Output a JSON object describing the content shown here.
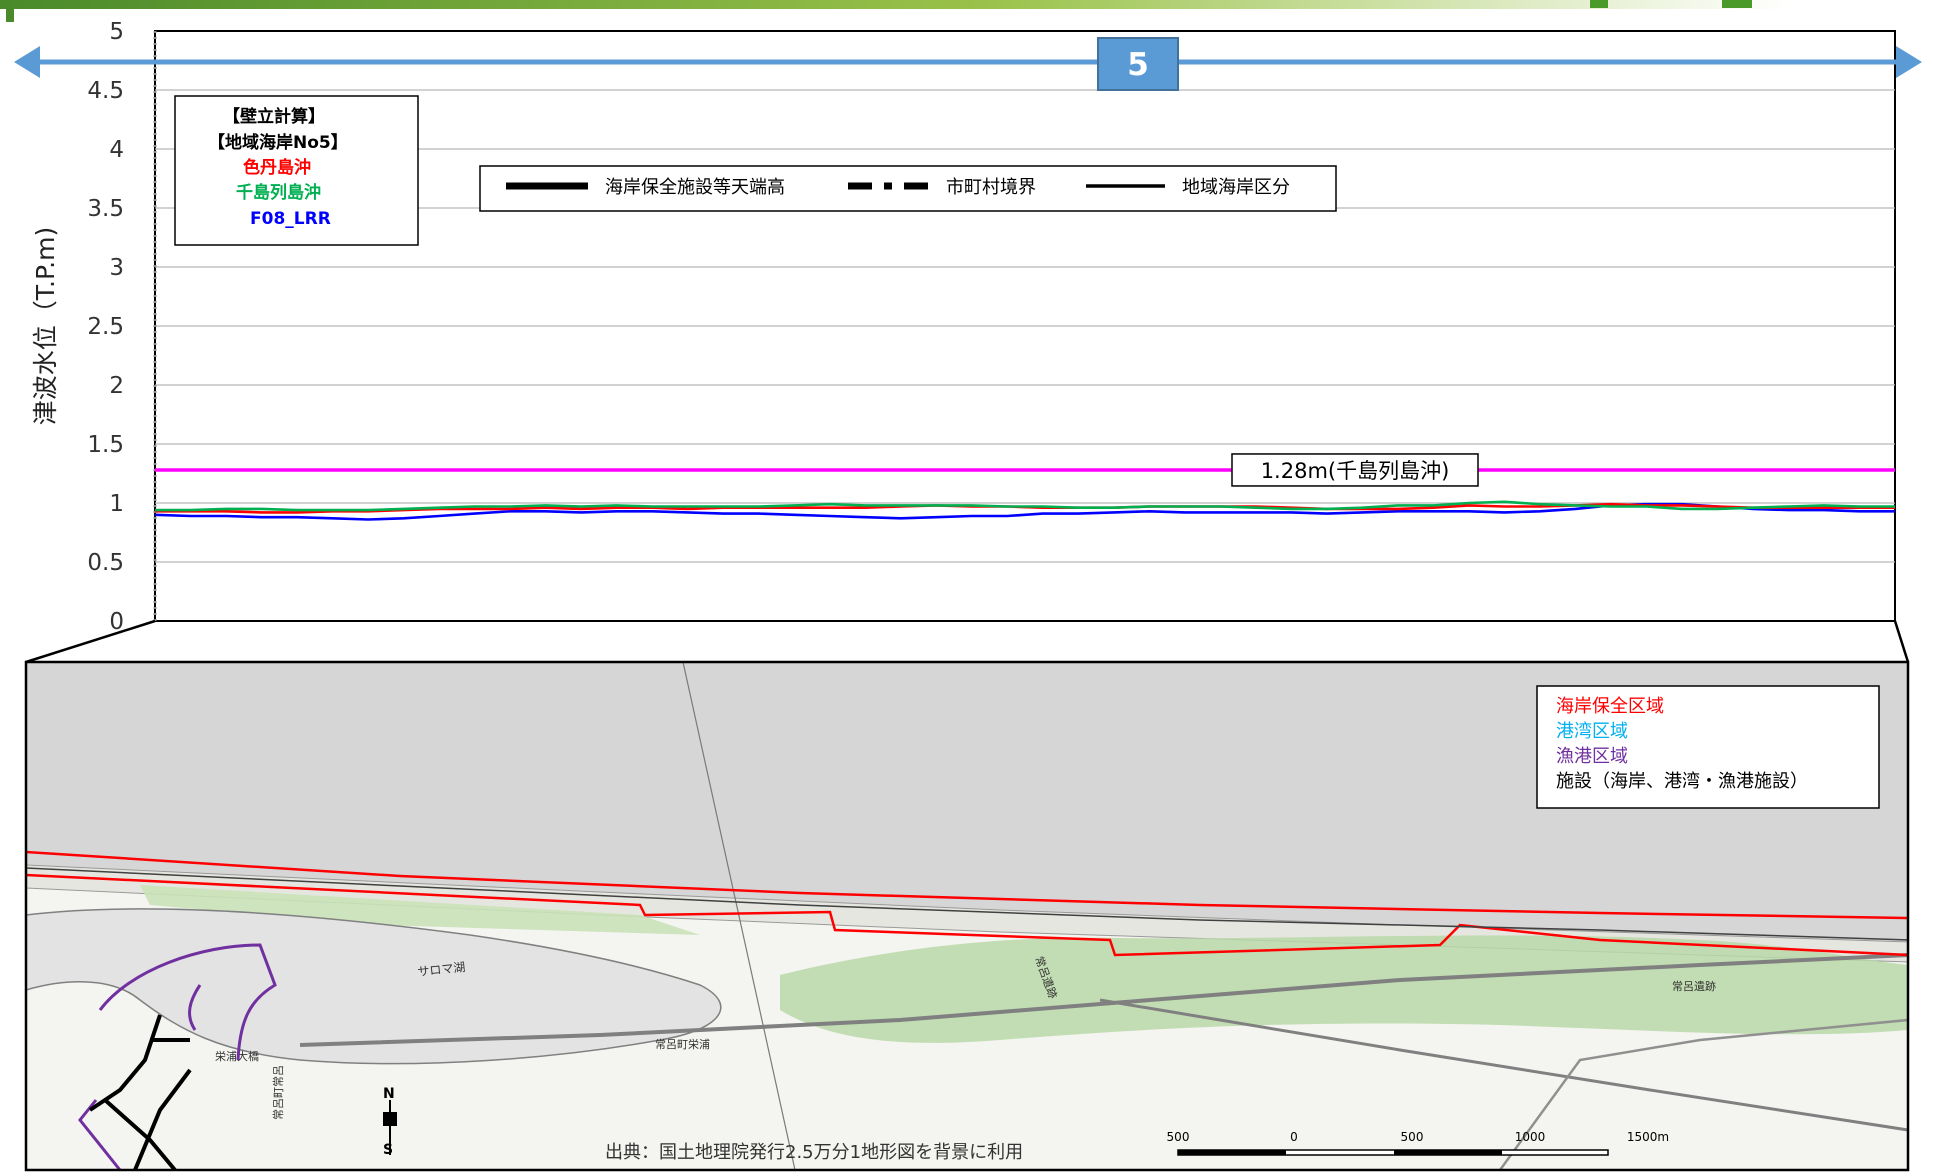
{
  "chart_data": {
    "type": "line",
    "ylabel": "津波水位（T.P.m)",
    "ylim": [
      0,
      5
    ],
    "yticks": [
      "0",
      "0.5",
      "1",
      "1.5",
      "2",
      "2.5",
      "3",
      "3.5",
      "4",
      "4.5",
      "5"
    ],
    "grid": true,
    "section_badge": "5",
    "info_box": {
      "line1": "【壁立計算】",
      "line2": "【地域海岸No5】",
      "line3": "色丹島沖",
      "line4": "千島列島沖",
      "line5": "F08_LRR"
    },
    "legend": {
      "item1": "海岸保全施設等天端高",
      "item2": "市町村境界",
      "item3": "地域海岸区分"
    },
    "reference_line": {
      "value": 1.28,
      "label": "1.28m(千島列島沖)",
      "color": "#ff00ff"
    },
    "series": [
      {
        "name": "色丹島沖",
        "color": "#ff0000",
        "values": [
          0.93,
          0.93,
          0.93,
          0.92,
          0.92,
          0.93,
          0.93,
          0.94,
          0.95,
          0.95,
          0.95,
          0.96,
          0.95,
          0.96,
          0.96,
          0.95,
          0.96,
          0.96,
          0.96,
          0.96,
          0.96,
          0.97,
          0.98,
          0.97,
          0.97,
          0.96,
          0.96,
          0.96,
          0.97,
          0.97,
          0.97,
          0.97,
          0.96,
          0.95,
          0.95,
          0.95,
          0.96,
          0.98,
          0.97,
          0.97,
          0.98,
          0.99,
          0.98,
          0.98,
          0.97,
          0.96,
          0.96,
          0.96,
          0.96,
          0.96
        ]
      },
      {
        "name": "千島列島沖",
        "color": "#00b050",
        "values": [
          0.94,
          0.94,
          0.95,
          0.95,
          0.94,
          0.94,
          0.94,
          0.95,
          0.96,
          0.97,
          0.97,
          0.98,
          0.97,
          0.98,
          0.97,
          0.97,
          0.97,
          0.97,
          0.98,
          0.99,
          0.98,
          0.98,
          0.98,
          0.98,
          0.97,
          0.97,
          0.96,
          0.96,
          0.97,
          0.97,
          0.97,
          0.96,
          0.95,
          0.95,
          0.96,
          0.98,
          0.98,
          1.0,
          1.01,
          0.99,
          0.98,
          0.97,
          0.97,
          0.95,
          0.95,
          0.96,
          0.97,
          0.98,
          0.97,
          0.97
        ]
      },
      {
        "name": "F08_LRR",
        "color": "#0000ff",
        "values": [
          0.9,
          0.89,
          0.89,
          0.88,
          0.88,
          0.87,
          0.86,
          0.87,
          0.89,
          0.91,
          0.93,
          0.93,
          0.92,
          0.93,
          0.93,
          0.92,
          0.91,
          0.91,
          0.9,
          0.89,
          0.88,
          0.87,
          0.88,
          0.89,
          0.89,
          0.91,
          0.91,
          0.92,
          0.93,
          0.92,
          0.92,
          0.92,
          0.92,
          0.91,
          0.92,
          0.93,
          0.93,
          0.93,
          0.92,
          0.93,
          0.95,
          0.98,
          0.99,
          0.99,
          0.97,
          0.95,
          0.94,
          0.94,
          0.93,
          0.93
        ]
      }
    ]
  },
  "map": {
    "legend": {
      "item1": "海岸保全区域",
      "item2": "港湾区域",
      "item3": "漁港区域",
      "item4": "施設（海岸、港湾・漁港施設）"
    },
    "colors": {
      "coast": "#ff0000",
      "port": "#00b0f0",
      "fishing": "#7030a0",
      "facility": "#000000"
    },
    "labels": {
      "lake": "サロマ湖",
      "bridge": "栄浦大橋",
      "town": "常呂町栄浦",
      "town2": "常呂町常呂",
      "ruins1": "常呂遺跡",
      "ruins2": "常呂遺跡",
      "north": "N",
      "south": "S"
    },
    "scale": [
      "500",
      "0",
      "500",
      "1000",
      "1500m"
    ],
    "source": "出典：国土地理院発行2.5万分1地形図を背景に利用"
  }
}
